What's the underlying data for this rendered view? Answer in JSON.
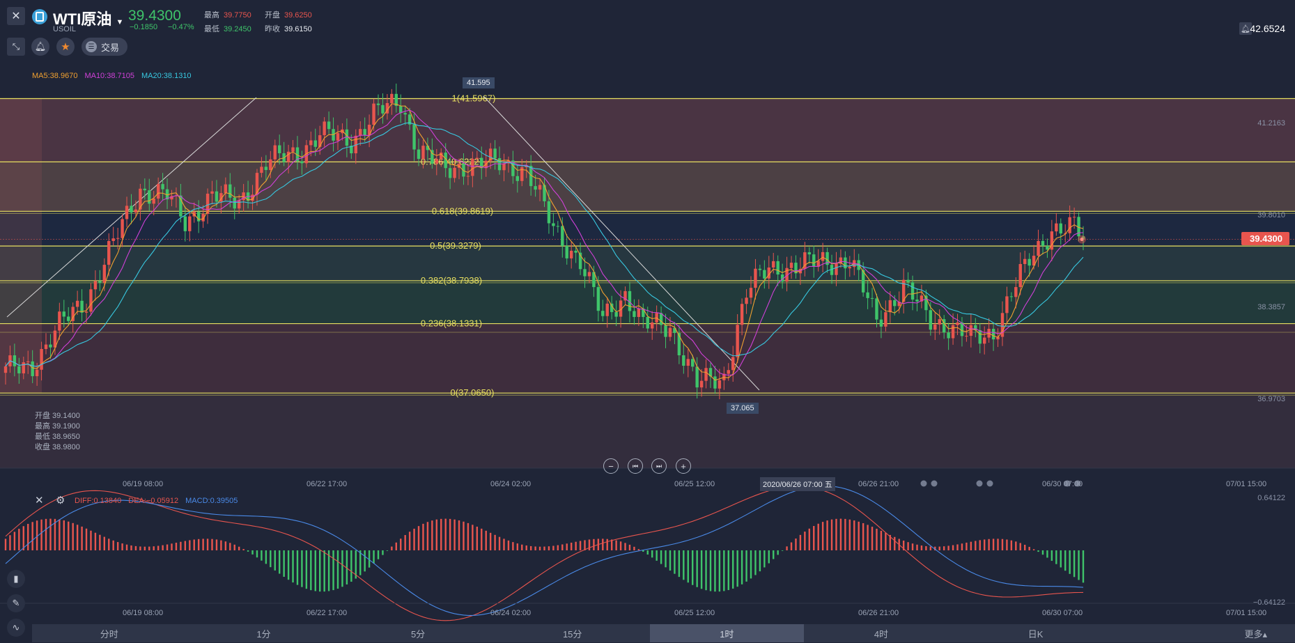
{
  "header": {
    "symbol_name": "WTI原油",
    "symbol_code": "USOIL",
    "price": "39.4300",
    "change": "−0.1850",
    "change_pct": "−0.47%",
    "stats": {
      "high_label": "最高",
      "high": "39.7750",
      "open_label": "开盘",
      "open": "39.6250",
      "low_label": "最低",
      "low": "39.2450",
      "prev_label": "昨收",
      "prev": "39.6150"
    },
    "trade_label": "交易",
    "top_right_value": "42.6524"
  },
  "ma_legend": {
    "ma5": "MA5:38.9670",
    "ma10": "MA10:38.7105",
    "ma20": "MA20:38.1310"
  },
  "fib": {
    "high_marker": "41.595",
    "low_marker": "37.065",
    "levels": [
      "1(41.5967)",
      "0.786(40.6222)",
      "0.618(39.8619)",
      "0.5(39.3279)",
      "0.382(38.7938)",
      "0.236(38.1331)",
      "0(37.0650)"
    ]
  },
  "right_axis": [
    "41.2163",
    "39.8010",
    "38.3857",
    "36.9703"
  ],
  "price_tag": "39.4300",
  "ohlc_panel": [
    "开盘 39.1400",
    "最高 39.1900",
    "最低 38.9650",
    "收盘 38.9800"
  ],
  "x_axis": [
    "06/19 08:00",
    "06/22 17:00",
    "06/24 02:00",
    "06/25 12:00",
    "06/26 21:00",
    "06/30 07:00",
    "07/01 15:00"
  ],
  "crosshair_date": "2020/06/26 07:00 五",
  "macd_legend": {
    "diff": "DIFF:0.13840",
    "dea": "DEA:−0.05912",
    "macd": "MACD:0.39505"
  },
  "macd_axis": [
    "0.64122",
    "−0.64122"
  ],
  "timeframes": [
    "分时",
    "1分",
    "5分",
    "15分",
    "1时",
    "4时",
    "日K",
    "更多▴"
  ],
  "active_timeframe": "1时",
  "colors": {
    "up": "#e8554e",
    "down": "#3fc46a",
    "ma5": "#f0a030",
    "ma10": "#d040d8",
    "ma20": "#38c8e0",
    "fib": "#e8e060",
    "diff": "#e8554e",
    "dea": "#4a8ae8",
    "background": "#1f2537"
  },
  "icons": [
    "close-icon",
    "logo-icon",
    "chevron-down-icon",
    "collapse-icon",
    "bell-icon",
    "star-icon",
    "trade-icon",
    "zoom-out-icon",
    "zoom-in-icon",
    "skip-start-icon",
    "skip-end-icon",
    "candle-icon",
    "pen-icon",
    "indicator-icon",
    "settings-icon"
  ]
}
